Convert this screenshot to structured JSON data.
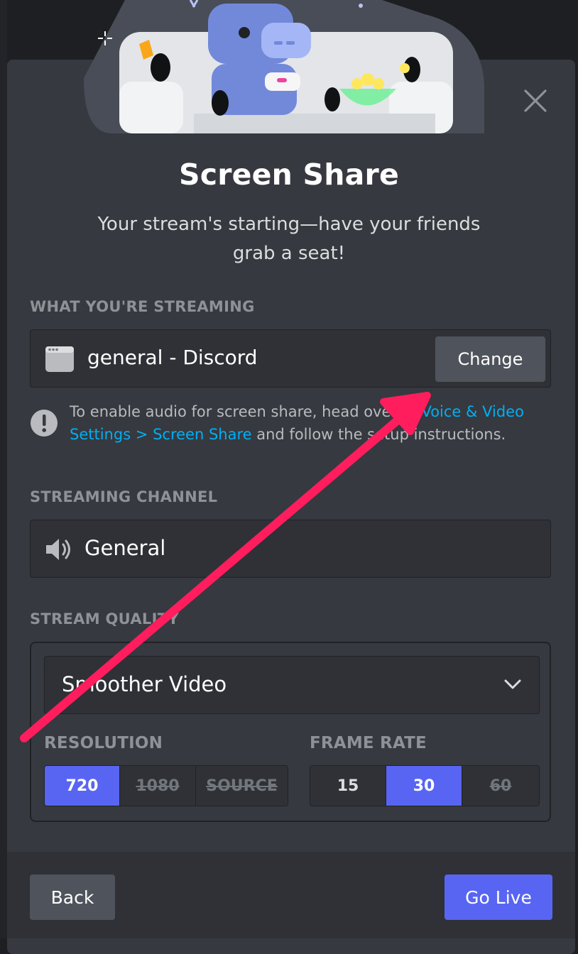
{
  "title": "Screen Share",
  "subtitle": "Your stream's starting—have your friends grab a seat!",
  "streaming": {
    "section_label": "WHAT YOU'RE STREAMING",
    "source_name": "general - Discord",
    "change_label": "Change",
    "notice_prefix": "To enable audio for screen share, head over to ",
    "notice_link": "Voice & Video Settings > Screen Share",
    "notice_suffix": " and follow the setup instructions."
  },
  "channel": {
    "section_label": "STREAMING CHANNEL",
    "name": "General"
  },
  "quality": {
    "section_label": "STREAM QUALITY",
    "preset": "Smoother Video",
    "resolution_label": "RESOLUTION",
    "resolution_options": [
      "720",
      "1080",
      "SOURCE"
    ],
    "resolution_selected": "720",
    "framerate_label": "FRAME RATE",
    "framerate_options": [
      "15",
      "30",
      "60"
    ],
    "framerate_selected": "30"
  },
  "footer": {
    "back_label": "Back",
    "golive_label": "Go Live"
  },
  "colors": {
    "modal_bg": "#36393f",
    "accent": "#5865f2",
    "link": "#00aff4",
    "annotation_arrow": "#ff1d5e"
  },
  "icons": {
    "close": "close-icon",
    "window": "window-icon",
    "info": "info-icon",
    "speaker": "speaker-icon",
    "chevron": "chevron-down-icon"
  }
}
